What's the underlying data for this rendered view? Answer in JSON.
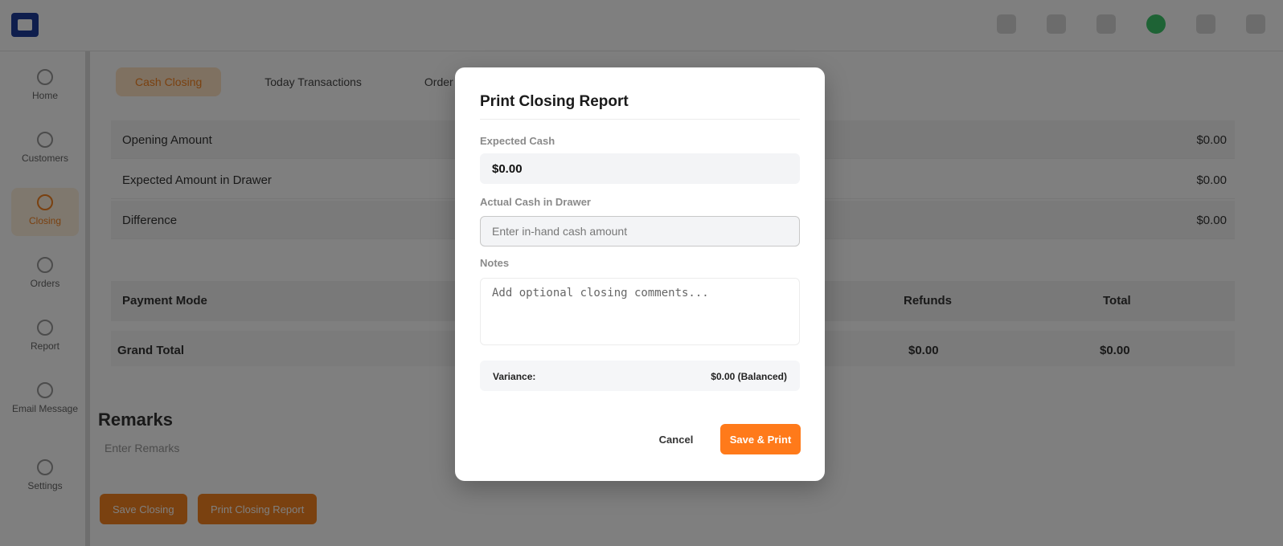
{
  "background": {
    "sidebar": [
      {
        "label": "Home"
      },
      {
        "label": "Customers"
      },
      {
        "label": "Closing"
      },
      {
        "label": "Orders"
      },
      {
        "label": "Report"
      },
      {
        "label": "Email Message"
      },
      {
        "label": "Settings"
      }
    ],
    "tabs": [
      "Cash Closing",
      "Today Transactions",
      "Order"
    ],
    "summary": [
      {
        "label": "Opening Amount",
        "value": "$0.00"
      },
      {
        "label": "Expected Amount in Drawer",
        "value": "$0.00"
      },
      {
        "label": "Difference",
        "value": "$0.00"
      }
    ],
    "payment_table": {
      "headers": [
        "Payment Mode",
        "Refunds",
        "Total"
      ],
      "total_row": {
        "label": "Grand Total",
        "refunds": "$0.00",
        "total": "$0.00"
      }
    },
    "remarks": {
      "title": "Remarks",
      "placeholder": "Enter Remarks"
    },
    "bottom_buttons": [
      "Save Closing",
      "Print Closing Report"
    ]
  },
  "modal": {
    "title": "Print Closing Report",
    "expected_cash": {
      "label": "Expected Cash",
      "value": "$0.00"
    },
    "actual_cash": {
      "label": "Actual Cash in Drawer",
      "placeholder": "Enter in-hand cash amount",
      "value": ""
    },
    "notes": {
      "label": "Notes",
      "placeholder": "Add optional closing comments..."
    },
    "variance": {
      "label": "Variance:",
      "value": "$0.00 (Balanced)"
    },
    "cancel_label": "Cancel",
    "save_label": "Save & Print"
  },
  "colors": {
    "accent": "#ff7a1a",
    "overlay": "rgba(0,0,0,0.5)"
  }
}
